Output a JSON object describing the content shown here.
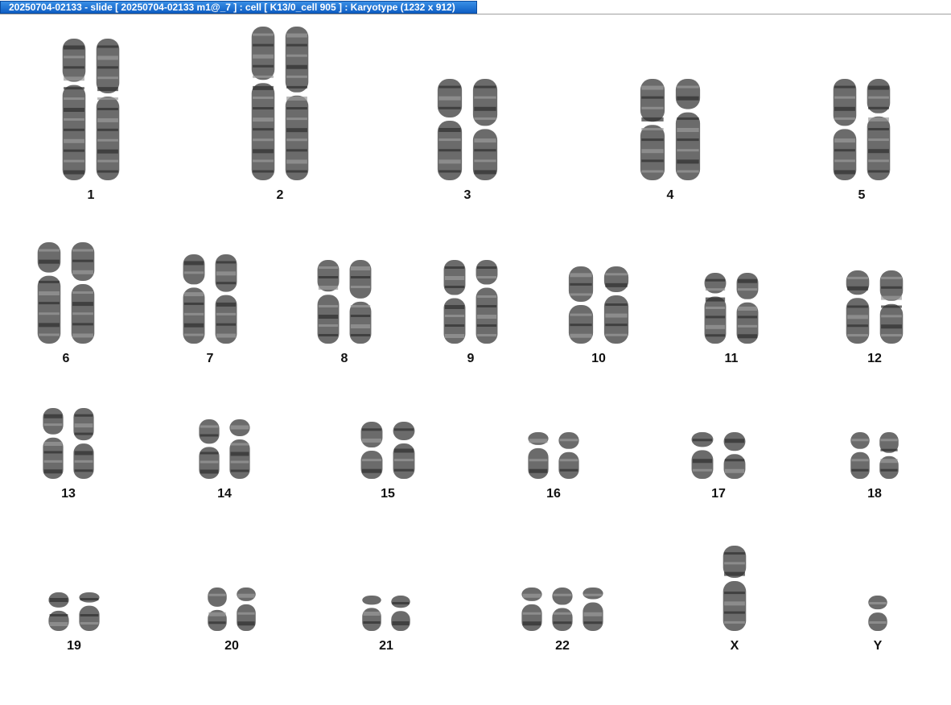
{
  "window": {
    "title": "20250704-02133 - slide [ 20250704-02133 m1@_7 ] : cell [ K13/0_cell 905 ] : Karyotype  (1232 x 912)"
  },
  "colors": {
    "chromatin": "#4a4a4a",
    "band_dark": "#2e2e2e",
    "band_light": "#9a9a9a",
    "titlebar": "#1a6fd6"
  },
  "chromosomes": [
    {
      "label": "1",
      "copies": 2
    },
    {
      "label": "2",
      "copies": 2
    },
    {
      "label": "3",
      "copies": 2
    },
    {
      "label": "4",
      "copies": 2
    },
    {
      "label": "5",
      "copies": 2
    },
    {
      "label": "6",
      "copies": 2
    },
    {
      "label": "7",
      "copies": 2
    },
    {
      "label": "8",
      "copies": 2
    },
    {
      "label": "9",
      "copies": 2
    },
    {
      "label": "10",
      "copies": 2
    },
    {
      "label": "11",
      "copies": 2
    },
    {
      "label": "12",
      "copies": 2
    },
    {
      "label": "13",
      "copies": 2
    },
    {
      "label": "14",
      "copies": 2
    },
    {
      "label": "15",
      "copies": 2
    },
    {
      "label": "16",
      "copies": 2
    },
    {
      "label": "17",
      "copies": 2
    },
    {
      "label": "18",
      "copies": 2
    },
    {
      "label": "19",
      "copies": 2
    },
    {
      "label": "20",
      "copies": 2
    },
    {
      "label": "21",
      "copies": 2
    },
    {
      "label": "22",
      "copies": 3
    },
    {
      "label": "X",
      "copies": 1
    },
    {
      "label": "Y",
      "copies": 1
    }
  ]
}
